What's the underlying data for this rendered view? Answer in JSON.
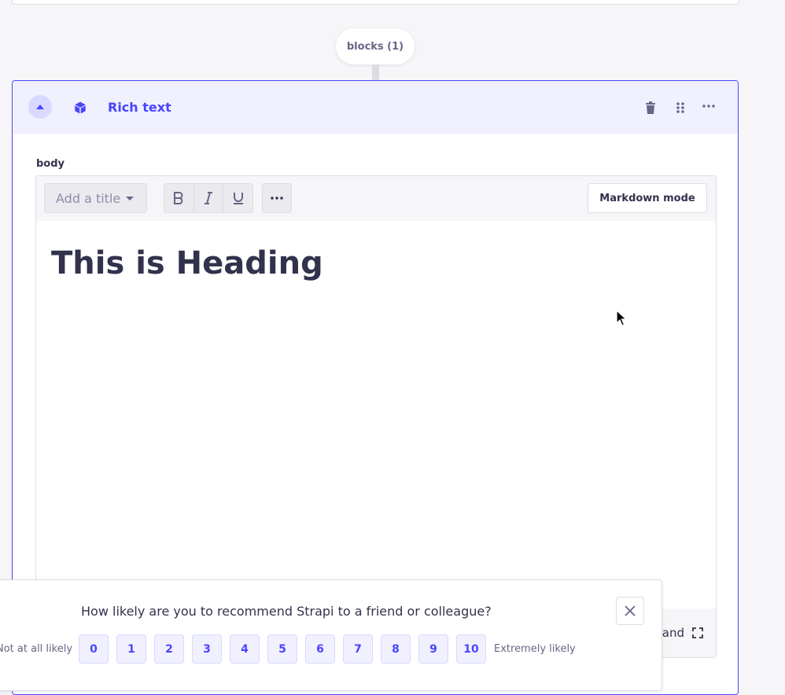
{
  "blocks_label": "blocks (1)",
  "component": {
    "title": "Rich text",
    "field_label": "body",
    "toolbar": {
      "title_select_placeholder": "Add a title",
      "bold_icon": "bold-icon",
      "italic_icon": "italic-icon",
      "underline_icon": "underline-icon",
      "more_icon": "more-icon",
      "markdown_mode_label": "Markdown mode"
    },
    "content_heading": "This is Heading",
    "expand_label": "and"
  },
  "survey": {
    "question": "How likely are you to recommend Strapi to a friend or colleague?",
    "low_label": "Not at all likely",
    "high_label": "Extremely likely",
    "scores": [
      "0",
      "1",
      "2",
      "3",
      "4",
      "5",
      "6",
      "7",
      "8",
      "9",
      "10"
    ]
  },
  "colors": {
    "primary": "#4945ff",
    "primary_light": "#f0f0ff",
    "text": "#32324d",
    "neutral_bg": "#f6f6f9"
  }
}
